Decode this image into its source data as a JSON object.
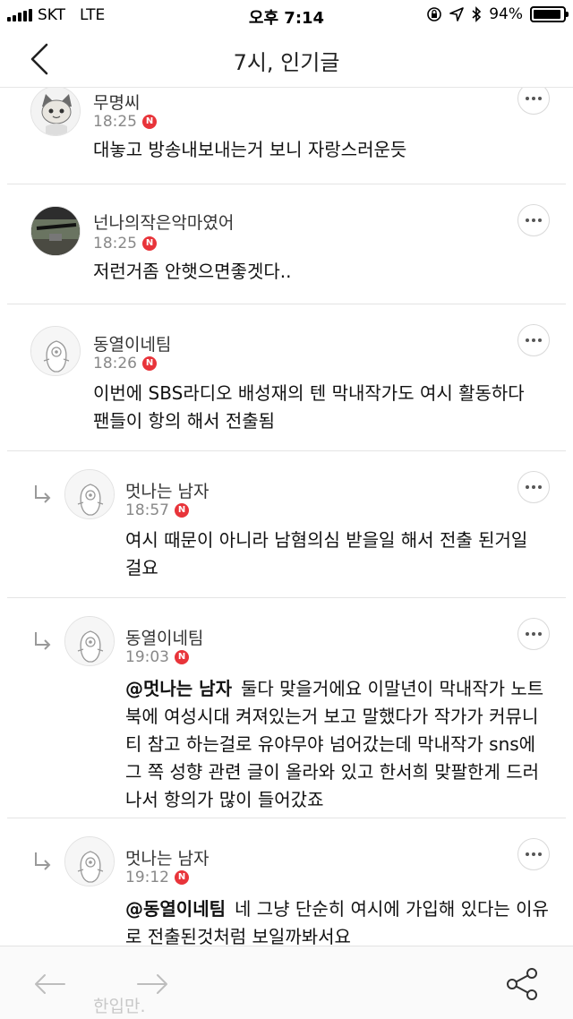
{
  "status_bar": {
    "carrier": "SKT",
    "network": "LTE",
    "time": "오후 7:14",
    "battery_percent": "94%",
    "battery_level": 0.94
  },
  "header": {
    "title": "7시, 인기글"
  },
  "comments": [
    {
      "author": "무명씨",
      "time": "18:25",
      "badge": "N",
      "text": "대놓고 방송내보내는거 보니 자랑스러운듯",
      "reply": false
    },
    {
      "author": "넌나의작은악마였어",
      "time": "18:25",
      "badge": "N",
      "text": "저런거좀 안햇으면좋겟다..",
      "reply": false
    },
    {
      "author": "동열이네팀",
      "time": "18:26",
      "badge": "N",
      "text": "이번에 SBS라디오 배성재의 텐 막내작가도 여시 활동하다 팬들이 항의 해서 전출됨",
      "reply": false
    },
    {
      "author": "멋나는 남자",
      "time": "18:57",
      "badge": "N",
      "text": "여시 때문이 아니라 남혐의심 받을일 해서 전출 된거일 걸요",
      "reply": true
    },
    {
      "author": "동열이네팀",
      "time": "19:03",
      "badge": "N",
      "mention": "@멋나는 남자",
      "text": "둘다 맞을거에요 이말년이 막내작가 노트북에 여성시대 켜져있는거 보고 말했다가 작가가 커뮤니티 참고 하는걸로 유야무야 넘어갔는데 막내작가 sns에 그 쪽 성향 관련 글이 올라와 있고 한서희 맞팔한게 드러나서 항의가 많이 들어갔죠",
      "reply": true
    },
    {
      "author": "멋나는 남자",
      "time": "19:12",
      "badge": "N",
      "mention": "@동열이네팀",
      "text": "네 그냥 단순히 여시에 가입해 있다는 이유로 전출된것처럼 보일까봐서요",
      "reply": true
    }
  ],
  "partial_next_author": "한입만.",
  "icons": {
    "back": "chevron-left-icon",
    "more": "more-dots-icon",
    "reply": "reply-arrow-icon",
    "nav_back": "arrow-left-icon",
    "nav_forward": "arrow-right-icon",
    "share": "share-icon",
    "location": "location-arrow-icon",
    "bluetooth": "bluetooth-icon",
    "rotation_lock": "rotation-lock-icon"
  },
  "colors": {
    "badge": "#e8343a",
    "divider": "#e4e4e4",
    "toolbar_bg": "#fafafa"
  }
}
